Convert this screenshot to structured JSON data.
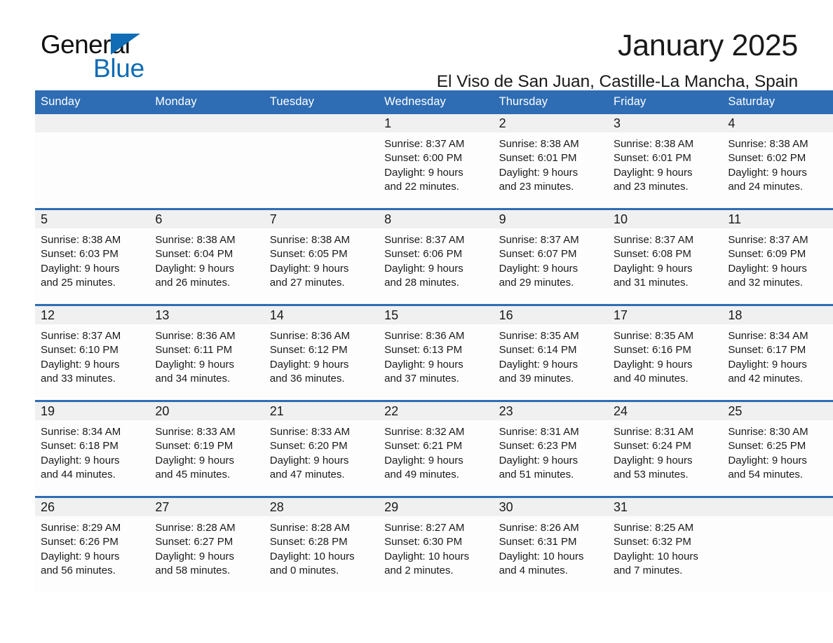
{
  "brand": {
    "line1": "General",
    "line2": "Blue",
    "accent_color": "#0F6CB5"
  },
  "header": {
    "title": "January 2025",
    "subtitle": "El Viso de San Juan, Castille-La Mancha, Spain"
  },
  "theme": {
    "header_blue": "#2E6DB4",
    "daynum_band": "#F0F0F0",
    "text": "#1a1a1a"
  },
  "calendar": {
    "weekday_headers": [
      "Sunday",
      "Monday",
      "Tuesday",
      "Wednesday",
      "Thursday",
      "Friday",
      "Saturday"
    ],
    "weeks": [
      [
        {
          "day": "",
          "lines": [
            "",
            "",
            "",
            ""
          ]
        },
        {
          "day": "",
          "lines": [
            "",
            "",
            "",
            ""
          ]
        },
        {
          "day": "",
          "lines": [
            "",
            "",
            "",
            ""
          ]
        },
        {
          "day": "1",
          "lines": [
            "Sunrise: 8:37 AM",
            "Sunset: 6:00 PM",
            "Daylight: 9 hours",
            "and 22 minutes."
          ]
        },
        {
          "day": "2",
          "lines": [
            "Sunrise: 8:38 AM",
            "Sunset: 6:01 PM",
            "Daylight: 9 hours",
            "and 23 minutes."
          ]
        },
        {
          "day": "3",
          "lines": [
            "Sunrise: 8:38 AM",
            "Sunset: 6:01 PM",
            "Daylight: 9 hours",
            "and 23 minutes."
          ]
        },
        {
          "day": "4",
          "lines": [
            "Sunrise: 8:38 AM",
            "Sunset: 6:02 PM",
            "Daylight: 9 hours",
            "and 24 minutes."
          ]
        }
      ],
      [
        {
          "day": "5",
          "lines": [
            "Sunrise: 8:38 AM",
            "Sunset: 6:03 PM",
            "Daylight: 9 hours",
            "and 25 minutes."
          ]
        },
        {
          "day": "6",
          "lines": [
            "Sunrise: 8:38 AM",
            "Sunset: 6:04 PM",
            "Daylight: 9 hours",
            "and 26 minutes."
          ]
        },
        {
          "day": "7",
          "lines": [
            "Sunrise: 8:38 AM",
            "Sunset: 6:05 PM",
            "Daylight: 9 hours",
            "and 27 minutes."
          ]
        },
        {
          "day": "8",
          "lines": [
            "Sunrise: 8:37 AM",
            "Sunset: 6:06 PM",
            "Daylight: 9 hours",
            "and 28 minutes."
          ]
        },
        {
          "day": "9",
          "lines": [
            "Sunrise: 8:37 AM",
            "Sunset: 6:07 PM",
            "Daylight: 9 hours",
            "and 29 minutes."
          ]
        },
        {
          "day": "10",
          "lines": [
            "Sunrise: 8:37 AM",
            "Sunset: 6:08 PM",
            "Daylight: 9 hours",
            "and 31 minutes."
          ]
        },
        {
          "day": "11",
          "lines": [
            "Sunrise: 8:37 AM",
            "Sunset: 6:09 PM",
            "Daylight: 9 hours",
            "and 32 minutes."
          ]
        }
      ],
      [
        {
          "day": "12",
          "lines": [
            "Sunrise: 8:37 AM",
            "Sunset: 6:10 PM",
            "Daylight: 9 hours",
            "and 33 minutes."
          ]
        },
        {
          "day": "13",
          "lines": [
            "Sunrise: 8:36 AM",
            "Sunset: 6:11 PM",
            "Daylight: 9 hours",
            "and 34 minutes."
          ]
        },
        {
          "day": "14",
          "lines": [
            "Sunrise: 8:36 AM",
            "Sunset: 6:12 PM",
            "Daylight: 9 hours",
            "and 36 minutes."
          ]
        },
        {
          "day": "15",
          "lines": [
            "Sunrise: 8:36 AM",
            "Sunset: 6:13 PM",
            "Daylight: 9 hours",
            "and 37 minutes."
          ]
        },
        {
          "day": "16",
          "lines": [
            "Sunrise: 8:35 AM",
            "Sunset: 6:14 PM",
            "Daylight: 9 hours",
            "and 39 minutes."
          ]
        },
        {
          "day": "17",
          "lines": [
            "Sunrise: 8:35 AM",
            "Sunset: 6:16 PM",
            "Daylight: 9 hours",
            "and 40 minutes."
          ]
        },
        {
          "day": "18",
          "lines": [
            "Sunrise: 8:34 AM",
            "Sunset: 6:17 PM",
            "Daylight: 9 hours",
            "and 42 minutes."
          ]
        }
      ],
      [
        {
          "day": "19",
          "lines": [
            "Sunrise: 8:34 AM",
            "Sunset: 6:18 PM",
            "Daylight: 9 hours",
            "and 44 minutes."
          ]
        },
        {
          "day": "20",
          "lines": [
            "Sunrise: 8:33 AM",
            "Sunset: 6:19 PM",
            "Daylight: 9 hours",
            "and 45 minutes."
          ]
        },
        {
          "day": "21",
          "lines": [
            "Sunrise: 8:33 AM",
            "Sunset: 6:20 PM",
            "Daylight: 9 hours",
            "and 47 minutes."
          ]
        },
        {
          "day": "22",
          "lines": [
            "Sunrise: 8:32 AM",
            "Sunset: 6:21 PM",
            "Daylight: 9 hours",
            "and 49 minutes."
          ]
        },
        {
          "day": "23",
          "lines": [
            "Sunrise: 8:31 AM",
            "Sunset: 6:23 PM",
            "Daylight: 9 hours",
            "and 51 minutes."
          ]
        },
        {
          "day": "24",
          "lines": [
            "Sunrise: 8:31 AM",
            "Sunset: 6:24 PM",
            "Daylight: 9 hours",
            "and 53 minutes."
          ]
        },
        {
          "day": "25",
          "lines": [
            "Sunrise: 8:30 AM",
            "Sunset: 6:25 PM",
            "Daylight: 9 hours",
            "and 54 minutes."
          ]
        }
      ],
      [
        {
          "day": "26",
          "lines": [
            "Sunrise: 8:29 AM",
            "Sunset: 6:26 PM",
            "Daylight: 9 hours",
            "and 56 minutes."
          ]
        },
        {
          "day": "27",
          "lines": [
            "Sunrise: 8:28 AM",
            "Sunset: 6:27 PM",
            "Daylight: 9 hours",
            "and 58 minutes."
          ]
        },
        {
          "day": "28",
          "lines": [
            "Sunrise: 8:28 AM",
            "Sunset: 6:28 PM",
            "Daylight: 10 hours",
            "and 0 minutes."
          ]
        },
        {
          "day": "29",
          "lines": [
            "Sunrise: 8:27 AM",
            "Sunset: 6:30 PM",
            "Daylight: 10 hours",
            "and 2 minutes."
          ]
        },
        {
          "day": "30",
          "lines": [
            "Sunrise: 8:26 AM",
            "Sunset: 6:31 PM",
            "Daylight: 10 hours",
            "and 4 minutes."
          ]
        },
        {
          "day": "31",
          "lines": [
            "Sunrise: 8:25 AM",
            "Sunset: 6:32 PM",
            "Daylight: 10 hours",
            "and 7 minutes."
          ]
        },
        {
          "day": "",
          "lines": [
            "",
            "",
            "",
            ""
          ]
        }
      ]
    ]
  }
}
